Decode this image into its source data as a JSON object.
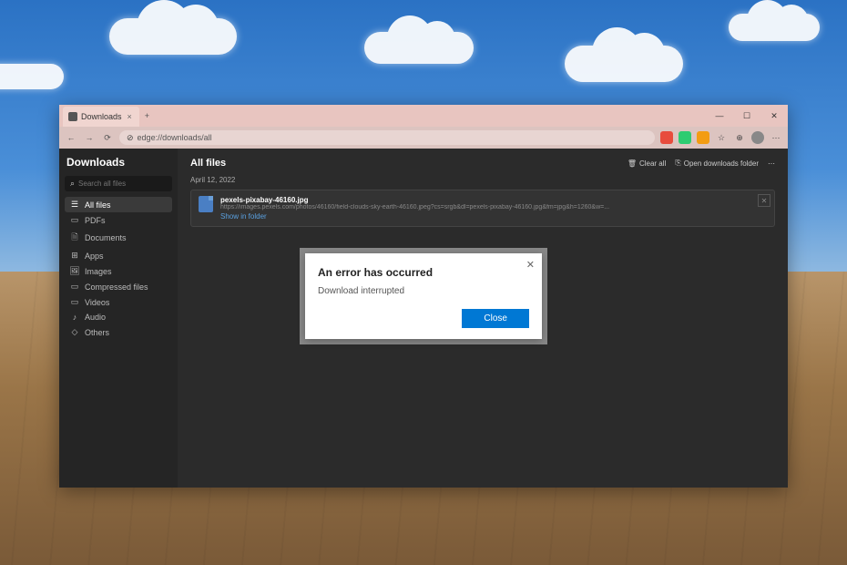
{
  "tab": {
    "title": "Downloads"
  },
  "window": {
    "min": "—",
    "max": "☐",
    "close": "✕"
  },
  "addressbar": {
    "url": "edge://downloads/all",
    "lock_icon": "⊘"
  },
  "sidebar": {
    "title": "Downloads",
    "search_placeholder": "Search all files",
    "items": [
      {
        "icon": "☰",
        "label": "All files",
        "active": true
      },
      {
        "icon": "▭",
        "label": "PDFs"
      },
      {
        "icon": "🗎",
        "label": "Documents"
      },
      {
        "icon": "⊞",
        "label": "Apps"
      },
      {
        "icon": "🖼",
        "label": "Images"
      },
      {
        "icon": "▭",
        "label": "Compressed files"
      },
      {
        "icon": "▭",
        "label": "Videos"
      },
      {
        "icon": "♪",
        "label": "Audio"
      },
      {
        "icon": "◇",
        "label": "Others"
      }
    ]
  },
  "main": {
    "title": "All files",
    "clear_all": "Clear all",
    "open_folder": "Open downloads folder",
    "date": "April 12, 2022",
    "item": {
      "name": "pexels-pixabay-46160.jpg",
      "url": "https://images.pexels.com/photos/46160/field-clouds-sky-earth-46160.jpeg?cs=srgb&dl=pexels-pixabay-46160.jpg&fm=jpg&h=1260&w=...",
      "show": "Show in folder"
    }
  },
  "modal": {
    "title": "An error has occurred",
    "body": "Download interrupted",
    "close_btn": "Close"
  }
}
